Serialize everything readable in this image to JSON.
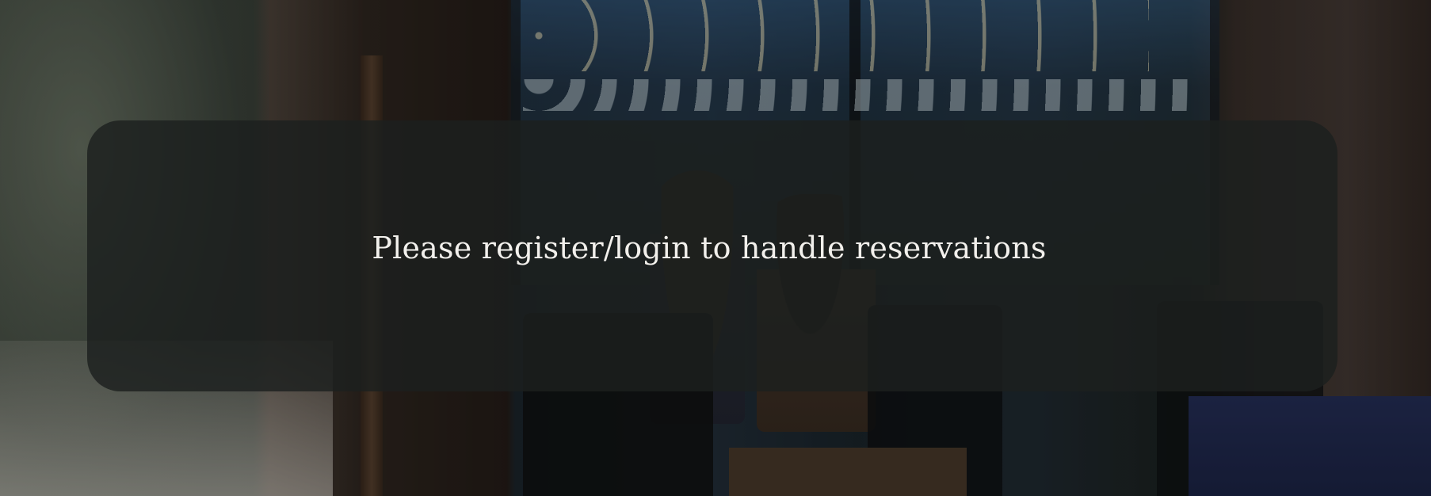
{
  "notice": {
    "message": "Please register/login to handle reservations"
  },
  "background": {
    "image": "cafe-interior-photo"
  }
}
